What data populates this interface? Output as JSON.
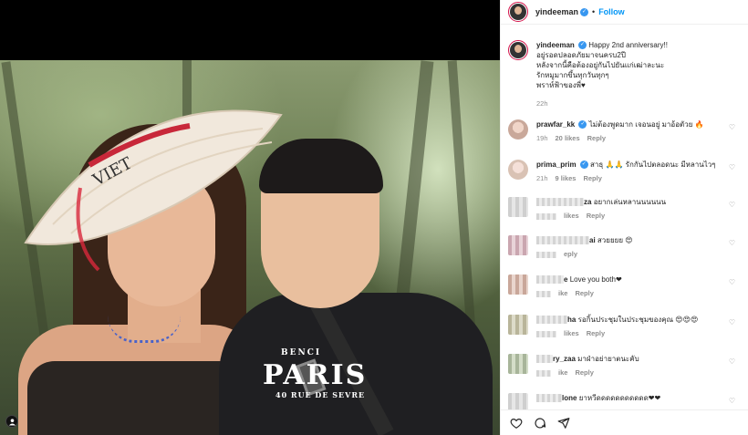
{
  "post": {
    "author": "yindeeman",
    "follow_label": "Follow",
    "separator": "•",
    "shirt_line1": "PARIS",
    "shirt_line2": "40 RUE DE SEVRE",
    "shirt_brand": "BENCI"
  },
  "caption": {
    "username": "yindeeman",
    "text_line1": "Happy 2nd anniversary!!",
    "text_line2": "อยู่รอดปลอดภัยมาจนครบ2ปี",
    "text_line3": "หลังจากนี้คือต้องอยู่กันไปยันแก่เฒ่าละนะ",
    "text_line4": "รักหมูมากขึ้นทุกวันทุกๆ",
    "text_line5": "พราห์ฟ้าของพี่♥",
    "time": "22h"
  },
  "comments": [
    {
      "username": "prawfar_kk",
      "text": "ไม่ต้องพูดมาก เจอนอยู่ มาอ้อตัวย 🔥",
      "time": "19h",
      "likes": "20 likes",
      "reply": "Reply",
      "verified": true
    },
    {
      "username": "prima_prim",
      "text": "สาธุ 🙏🙏 รักกันไปตลอดนะ มีหลานไวๆ",
      "time": "21h",
      "likes": "9 likes",
      "reply": "Reply",
      "verified": true
    },
    {
      "username_suffix": "za",
      "text": "อยากเล่นหลานนนนนน",
      "likes": "likes",
      "reply": "Reply"
    },
    {
      "username_suffix": "ai",
      "text": "สวยยยย 😍",
      "likes": "",
      "reply": "eply"
    },
    {
      "username_suffix": "e",
      "text": "Love you both❤",
      "likes": "ike",
      "reply": "Reply"
    },
    {
      "username_suffix": "ha",
      "text": "รอกิ้นประชุมในประชุมของคุณ 😍😍😍",
      "likes": "likes",
      "reply": "Reply"
    },
    {
      "username_suffix": "ry_zaa",
      "text": "มาฝ่าอย่ายาตนะคับ",
      "likes": "ike",
      "reply": "Reply"
    },
    {
      "username_suffix": "lone",
      "text": "ยาหวีดดดดดดดดดดด❤❤",
      "likes": "",
      "reply": ""
    }
  ],
  "icons": {
    "like": "heart-icon",
    "comment": "comment-icon",
    "share": "share-icon",
    "tag": "person-tag-icon"
  }
}
